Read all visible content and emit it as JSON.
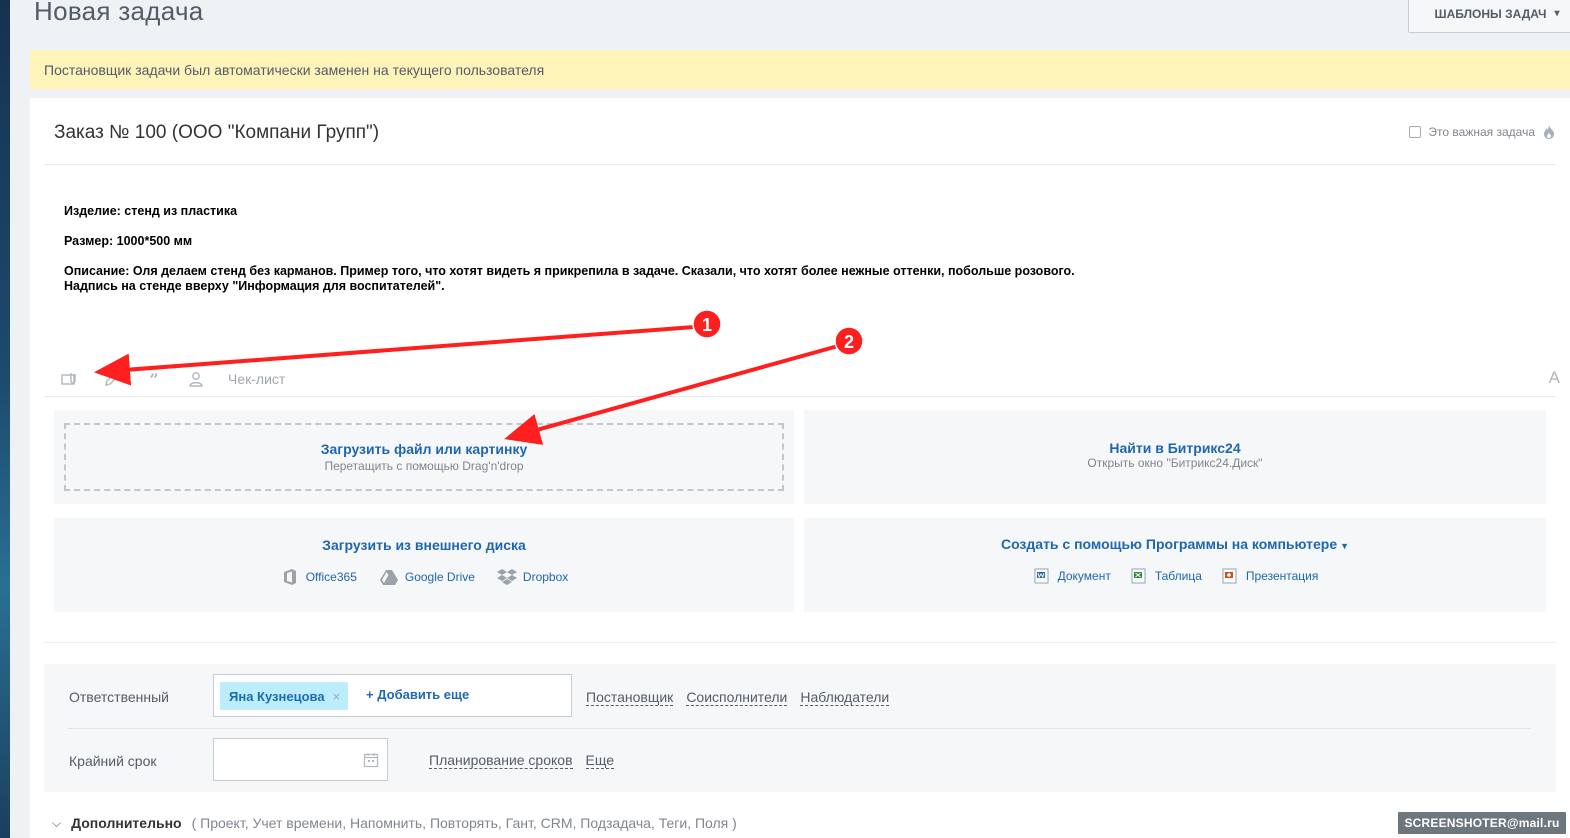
{
  "page": {
    "title": "Новая задача",
    "templates_button": "ШАБЛОНЫ ЗАДАЧ",
    "notice": "Постановщик задачи был автоматически заменен на текущего пользователя"
  },
  "task": {
    "title": "Заказ № 100 (ООО \"Компани Групп\")",
    "important_label": "Это важная задача",
    "important_checked": false,
    "description": {
      "line1": "Изделие: стенд из пластика",
      "line2": "Размер: 1000*500 мм",
      "line3": "Описание: Оля делаем стенд без карманов. Пример того, что хотят видеть я прикрепила в задаче. Сказали, что хотят более нежные оттенки, побольше розового.",
      "line4": "Надпись на стенде вверху \"Информация для воспитателей\"."
    }
  },
  "toolbar": {
    "icons": [
      "attach-file-icon",
      "edit-icon",
      "quote-icon",
      "person-icon"
    ],
    "checklist_label": "Чек-лист",
    "font_label": "A"
  },
  "upload": {
    "upload_title": "Загрузить файл или картинку",
    "upload_sub": "Перетащить с помощью Drag'n'drop",
    "find_title": "Найти в Битрикс24",
    "find_sub": "Открыть окно \"Битрикс24.Диск\"",
    "external_title": "Загрузить из внешнего диска",
    "services": [
      "Office365",
      "Google Drive",
      "Dropbox"
    ],
    "create_title": "Создать с помощью Программы на компьютере",
    "docs": [
      "Документ",
      "Таблица",
      "Презентация"
    ]
  },
  "settings": {
    "responsible_label": "Ответственный",
    "responsible_person": "Яна Кузнецова",
    "add_more": "+ Добавить еще",
    "role_links": [
      "Постановщик",
      "Соисполнители",
      "Наблюдатели"
    ],
    "deadline_label": "Крайний срок",
    "deadline_value": "",
    "date_links": [
      "Планирование сроков",
      "Еще"
    ]
  },
  "extra": {
    "label": "Дополнительно",
    "items": "( Проект,  Учет времени,  Напомнить,  Повторять,  Гант,  CRM,  Подзадача,  Теги,  Поля )"
  },
  "annotations": {
    "marker1": "1",
    "marker2": "2",
    "color": "#ff1f1f"
  },
  "watermark": "SCREENSHOTER@mail.ru"
}
